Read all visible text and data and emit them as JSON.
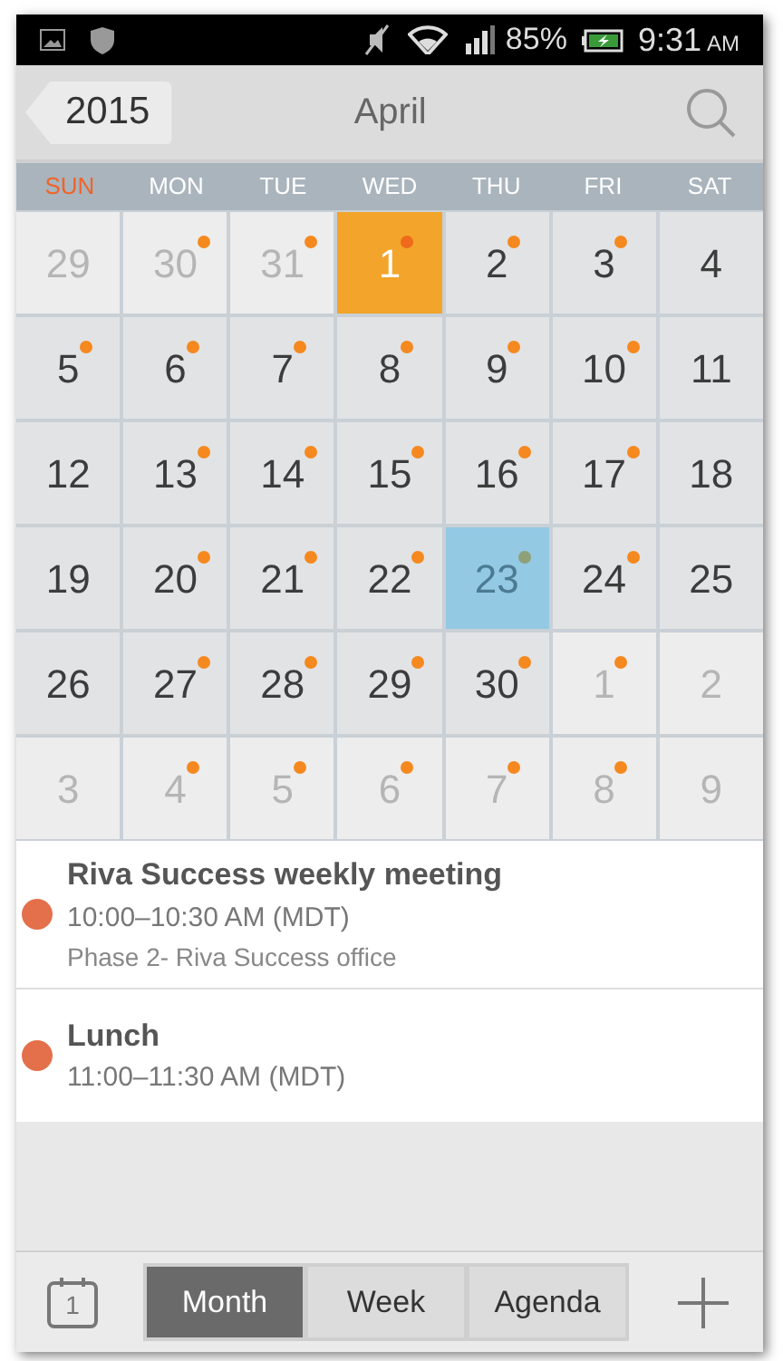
{
  "status_bar": {
    "battery": "85%",
    "time": "9:31",
    "meridiem": "AM"
  },
  "header": {
    "back_label": "2015",
    "title": "April"
  },
  "weekdays": [
    {
      "label": "SUN",
      "highlight": true
    },
    {
      "label": "MON",
      "highlight": false
    },
    {
      "label": "TUE",
      "highlight": false
    },
    {
      "label": "WED",
      "highlight": false
    },
    {
      "label": "THU",
      "highlight": false
    },
    {
      "label": "FRI",
      "highlight": false
    },
    {
      "label": "SAT",
      "highlight": false
    }
  ],
  "weeks": [
    [
      {
        "day": "29",
        "kind": "other",
        "has_event": false
      },
      {
        "day": "30",
        "kind": "other",
        "has_event": true
      },
      {
        "day": "31",
        "kind": "other",
        "has_event": true
      },
      {
        "day": "1",
        "kind": "selected",
        "has_event": true
      },
      {
        "day": "2",
        "kind": "month",
        "has_event": true
      },
      {
        "day": "3",
        "kind": "month",
        "has_event": true
      },
      {
        "day": "4",
        "kind": "month",
        "has_event": false
      }
    ],
    [
      {
        "day": "5",
        "kind": "month",
        "has_event": true
      },
      {
        "day": "6",
        "kind": "month",
        "has_event": true
      },
      {
        "day": "7",
        "kind": "month",
        "has_event": true
      },
      {
        "day": "8",
        "kind": "month",
        "has_event": true
      },
      {
        "day": "9",
        "kind": "month",
        "has_event": true
      },
      {
        "day": "10",
        "kind": "month",
        "has_event": true
      },
      {
        "day": "11",
        "kind": "month",
        "has_event": false
      }
    ],
    [
      {
        "day": "12",
        "kind": "month",
        "has_event": false
      },
      {
        "day": "13",
        "kind": "month",
        "has_event": true
      },
      {
        "day": "14",
        "kind": "month",
        "has_event": true
      },
      {
        "day": "15",
        "kind": "month",
        "has_event": true
      },
      {
        "day": "16",
        "kind": "month",
        "has_event": true
      },
      {
        "day": "17",
        "kind": "month",
        "has_event": true
      },
      {
        "day": "18",
        "kind": "month",
        "has_event": false
      }
    ],
    [
      {
        "day": "19",
        "kind": "month",
        "has_event": false
      },
      {
        "day": "20",
        "kind": "month",
        "has_event": true
      },
      {
        "day": "21",
        "kind": "month",
        "has_event": true
      },
      {
        "day": "22",
        "kind": "month",
        "has_event": true
      },
      {
        "day": "23",
        "kind": "today",
        "has_event": true
      },
      {
        "day": "24",
        "kind": "month",
        "has_event": true
      },
      {
        "day": "25",
        "kind": "month",
        "has_event": false
      }
    ],
    [
      {
        "day": "26",
        "kind": "month",
        "has_event": false
      },
      {
        "day": "27",
        "kind": "month",
        "has_event": true
      },
      {
        "day": "28",
        "kind": "month",
        "has_event": true
      },
      {
        "day": "29",
        "kind": "month",
        "has_event": true
      },
      {
        "day": "30",
        "kind": "month",
        "has_event": true
      },
      {
        "day": "1",
        "kind": "other",
        "has_event": true
      },
      {
        "day": "2",
        "kind": "other",
        "has_event": false
      }
    ],
    [
      {
        "day": "3",
        "kind": "other",
        "has_event": false
      },
      {
        "day": "4",
        "kind": "other",
        "has_event": true
      },
      {
        "day": "5",
        "kind": "other",
        "has_event": true
      },
      {
        "day": "6",
        "kind": "other",
        "has_event": true
      },
      {
        "day": "7",
        "kind": "other",
        "has_event": true
      },
      {
        "day": "8",
        "kind": "other",
        "has_event": true
      },
      {
        "day": "9",
        "kind": "other",
        "has_event": false
      }
    ]
  ],
  "events": [
    {
      "title": "Riva Success weekly meeting",
      "time": "10:00–10:30 AM (MDT)",
      "location": "Phase 2- Riva Success office",
      "color": "#e3704a"
    },
    {
      "title": "Lunch",
      "time": "11:00–11:30 AM (MDT)",
      "color": "#e3704a"
    }
  ],
  "today_button": {
    "label": "1"
  },
  "view_tabs": [
    {
      "label": "Month",
      "selected": true
    },
    {
      "label": "Week",
      "selected": false
    },
    {
      "label": "Agenda",
      "selected": false
    }
  ]
}
